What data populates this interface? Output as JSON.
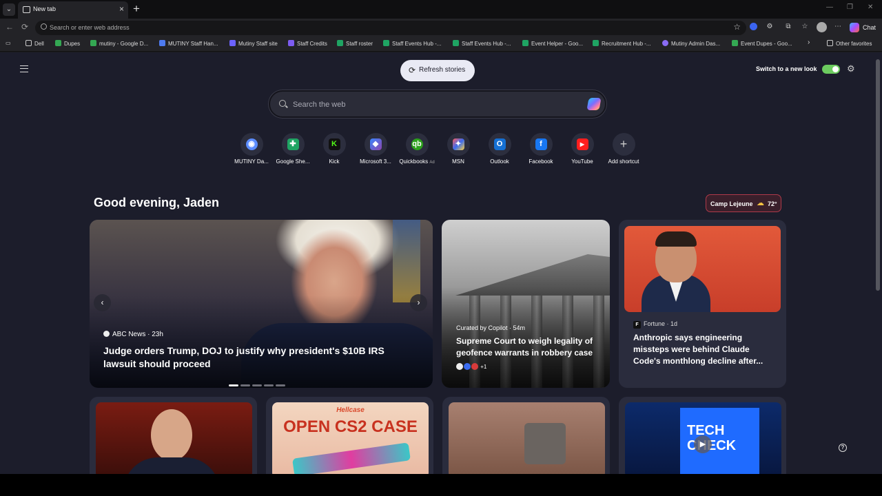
{
  "browser": {
    "tab_title": "New tab",
    "address_placeholder": "Search or enter web address",
    "chat_label": "Chat",
    "bookmarks": [
      {
        "label": "Dell",
        "color": "#f0c75e"
      },
      {
        "label": "Dupes",
        "color": "#34a853"
      },
      {
        "label": "mutiny - Google D...",
        "color": "#34a853"
      },
      {
        "label": "MUTINY Staff Han...",
        "color": "#4e7bf0"
      },
      {
        "label": "Mutiny Staff site",
        "color": "#6c63ff"
      },
      {
        "label": "Staff Credits",
        "color": "#7d5cf0"
      },
      {
        "label": "Staff roster",
        "color": "#1fa463"
      },
      {
        "label": "Staff Events Hub -...",
        "color": "#1fa463"
      },
      {
        "label": "Staff Events Hub -...",
        "color": "#1fa463"
      },
      {
        "label": "Event Helper - Goo...",
        "color": "#1fa463"
      },
      {
        "label": "Recruitment Hub -...",
        "color": "#1fa463"
      },
      {
        "label": "Mutiny Admin Das...",
        "color": "#8a6cf5"
      },
      {
        "label": "Event Dupes - Goo...",
        "color": "#34a853"
      }
    ],
    "other_favorites": "Other favorites"
  },
  "page": {
    "refresh_label": "Refresh stories",
    "switch_label": "Switch to a new look",
    "search_placeholder": "Search the web",
    "shortcuts": [
      {
        "label": "MUTINY Da...",
        "icon": "mutiny-icon",
        "color": "#5b8cff"
      },
      {
        "label": "Google She...",
        "icon": "sheets-icon",
        "color": "#1fa463"
      },
      {
        "label": "Kick",
        "icon": "kick-icon",
        "color": "#111"
      },
      {
        "label": "Microsoft 3...",
        "icon": "microsoft365-icon",
        "color": "#5a3fd6"
      },
      {
        "label": "Quickbooks",
        "icon": "quickbooks-icon",
        "color": "#2ca01c",
        "ad": "Ad"
      },
      {
        "label": "MSN",
        "icon": "msn-icon",
        "color": "#3b6cf0"
      },
      {
        "label": "Outlook",
        "icon": "outlook-icon",
        "color": "#1570d4"
      },
      {
        "label": "Facebook",
        "icon": "facebook-icon",
        "color": "#1877f2"
      },
      {
        "label": "YouTube",
        "icon": "youtube-icon",
        "color": "#ff1e1e"
      },
      {
        "label": "Add shortcut",
        "icon": "plus-icon",
        "color": "#2c2e3e"
      }
    ],
    "greeting": "Good evening, Jaden",
    "weather": {
      "location": "Camp Lejeune",
      "temp": "72°"
    },
    "hero": {
      "source": "ABC News",
      "age": "23h",
      "title": "Judge orders Trump, DOJ to justify why president's $10B IRS lawsuit should proceed"
    },
    "card2": {
      "source": "Curated by Copilot",
      "age": "54m",
      "title": "Supreme Court to weigh legality of geofence warrants in robbery case",
      "extra": "+1"
    },
    "card3": {
      "source": "Fortune",
      "age": "1d",
      "title": "Anthropic says engineering missteps were behind Claude Code's monthlong decline after..."
    },
    "card5": {
      "title_line1": "Hellcase",
      "title_line2": "OPEN CS2 CASE"
    },
    "card7": {
      "line1": "TECH",
      "line2": "CHECK"
    }
  }
}
